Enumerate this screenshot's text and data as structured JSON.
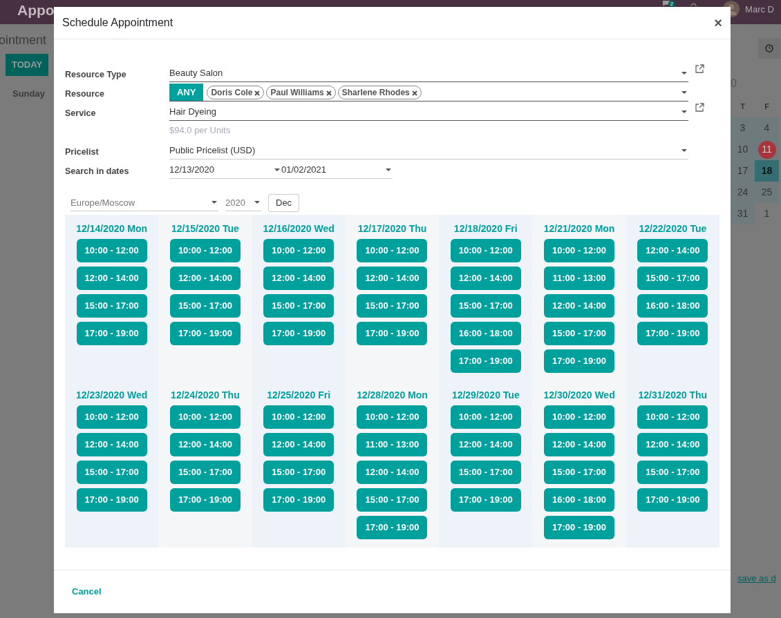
{
  "app_bar": {
    "brand": "Appo",
    "chat_badge": "2",
    "user": "Marc D"
  },
  "background": {
    "title": "ointment",
    "today_button": "TODAY",
    "day_header": "Sunday",
    "month_fragment": "0",
    "weekdays": [
      "T",
      "F"
    ],
    "weeks": [
      [
        {
          "day": "3",
          "kind": "normal"
        },
        {
          "day": "4",
          "kind": "normal"
        }
      ],
      [
        {
          "day": "10",
          "kind": "normal"
        },
        {
          "day": "11",
          "kind": "today"
        }
      ],
      [
        {
          "day": "17",
          "kind": "normal"
        },
        {
          "day": "18",
          "kind": "selected"
        }
      ],
      [
        {
          "day": "24",
          "kind": "normal"
        },
        {
          "day": "25",
          "kind": "normal"
        }
      ],
      [
        {
          "day": "31",
          "kind": "normal"
        },
        {
          "day": "1",
          "kind": "other"
        }
      ]
    ],
    "save_link": "save as d"
  },
  "modal": {
    "title": "Schedule Appointment",
    "close": "×",
    "fields": [
      {
        "label": "Resource Type",
        "kind": "select",
        "value": "Beauty Salon",
        "external_link": true
      },
      {
        "label": "Resource",
        "kind": "tags",
        "any_label": "ANY",
        "tags": [
          "Doris Cole",
          "Paul Williams",
          "Sharlene Rhodes"
        ]
      },
      {
        "label": "Service",
        "kind": "select",
        "value": "Hair Dyeing",
        "external_link": true,
        "hint": "$94.0 per Units"
      },
      {
        "label": "Pricelist",
        "kind": "select",
        "value": "Public Pricelist (USD)",
        "external_link": false
      },
      {
        "label": "Search in dates",
        "kind": "daterange",
        "start": "12/13/2020",
        "end": "01/02/2021"
      }
    ],
    "filters": {
      "timezone": "Europe/Moscow",
      "year": "2020",
      "month": "Dec"
    },
    "days": [
      {
        "date": "12/14/2020 Mon",
        "slots": [
          "10:00 - 12:00",
          "12:00 - 14:00",
          "15:00 - 17:00",
          "17:00 - 19:00"
        ]
      },
      {
        "date": "12/15/2020 Tue",
        "slots": [
          "10:00 - 12:00",
          "12:00 - 14:00",
          "15:00 - 17:00",
          "17:00 - 19:00"
        ]
      },
      {
        "date": "12/16/2020 Wed",
        "slots": [
          "10:00 - 12:00",
          "12:00 - 14:00",
          "15:00 - 17:00",
          "17:00 - 19:00"
        ]
      },
      {
        "date": "12/17/2020 Thu",
        "slots": [
          "10:00 - 12:00",
          "12:00 - 14:00",
          "15:00 - 17:00",
          "17:00 - 19:00"
        ]
      },
      {
        "date": "12/18/2020 Fri",
        "slots": [
          "10:00 - 12:00",
          "12:00 - 14:00",
          "15:00 - 17:00",
          "16:00 - 18:00",
          "17:00 - 19:00"
        ]
      },
      {
        "date": "12/21/2020 Mon",
        "slots": [
          "10:00 - 12:00",
          "11:00 - 13:00",
          "12:00 - 14:00",
          "15:00 - 17:00",
          "17:00 - 19:00"
        ]
      },
      {
        "date": "12/22/2020 Tue",
        "slots": [
          "12:00 - 14:00",
          "15:00 - 17:00",
          "16:00 - 18:00",
          "17:00 - 19:00"
        ]
      },
      {
        "date": "12/23/2020 Wed",
        "slots": [
          "10:00 - 12:00",
          "12:00 - 14:00",
          "15:00 - 17:00",
          "17:00 - 19:00"
        ]
      },
      {
        "date": "12/24/2020 Thu",
        "slots": [
          "10:00 - 12:00",
          "12:00 - 14:00",
          "15:00 - 17:00",
          "17:00 - 19:00"
        ]
      },
      {
        "date": "12/25/2020 Fri",
        "slots": [
          "10:00 - 12:00",
          "12:00 - 14:00",
          "15:00 - 17:00",
          "17:00 - 19:00"
        ]
      },
      {
        "date": "12/28/2020 Mon",
        "slots": [
          "10:00 - 12:00",
          "11:00 - 13:00",
          "12:00 - 14:00",
          "15:00 - 17:00",
          "17:00 - 19:00"
        ]
      },
      {
        "date": "12/29/2020 Tue",
        "slots": [
          "10:00 - 12:00",
          "12:00 - 14:00",
          "15:00 - 17:00",
          "17:00 - 19:00"
        ]
      },
      {
        "date": "12/30/2020 Wed",
        "slots": [
          "10:00 - 12:00",
          "12:00 - 14:00",
          "15:00 - 17:00",
          "16:00 - 18:00",
          "17:00 - 19:00"
        ]
      },
      {
        "date": "12/31/2020 Thu",
        "slots": [
          "10:00 - 12:00",
          "12:00 - 14:00",
          "15:00 - 17:00",
          "17:00 - 19:00"
        ]
      }
    ],
    "cancel": "Cancel"
  }
}
